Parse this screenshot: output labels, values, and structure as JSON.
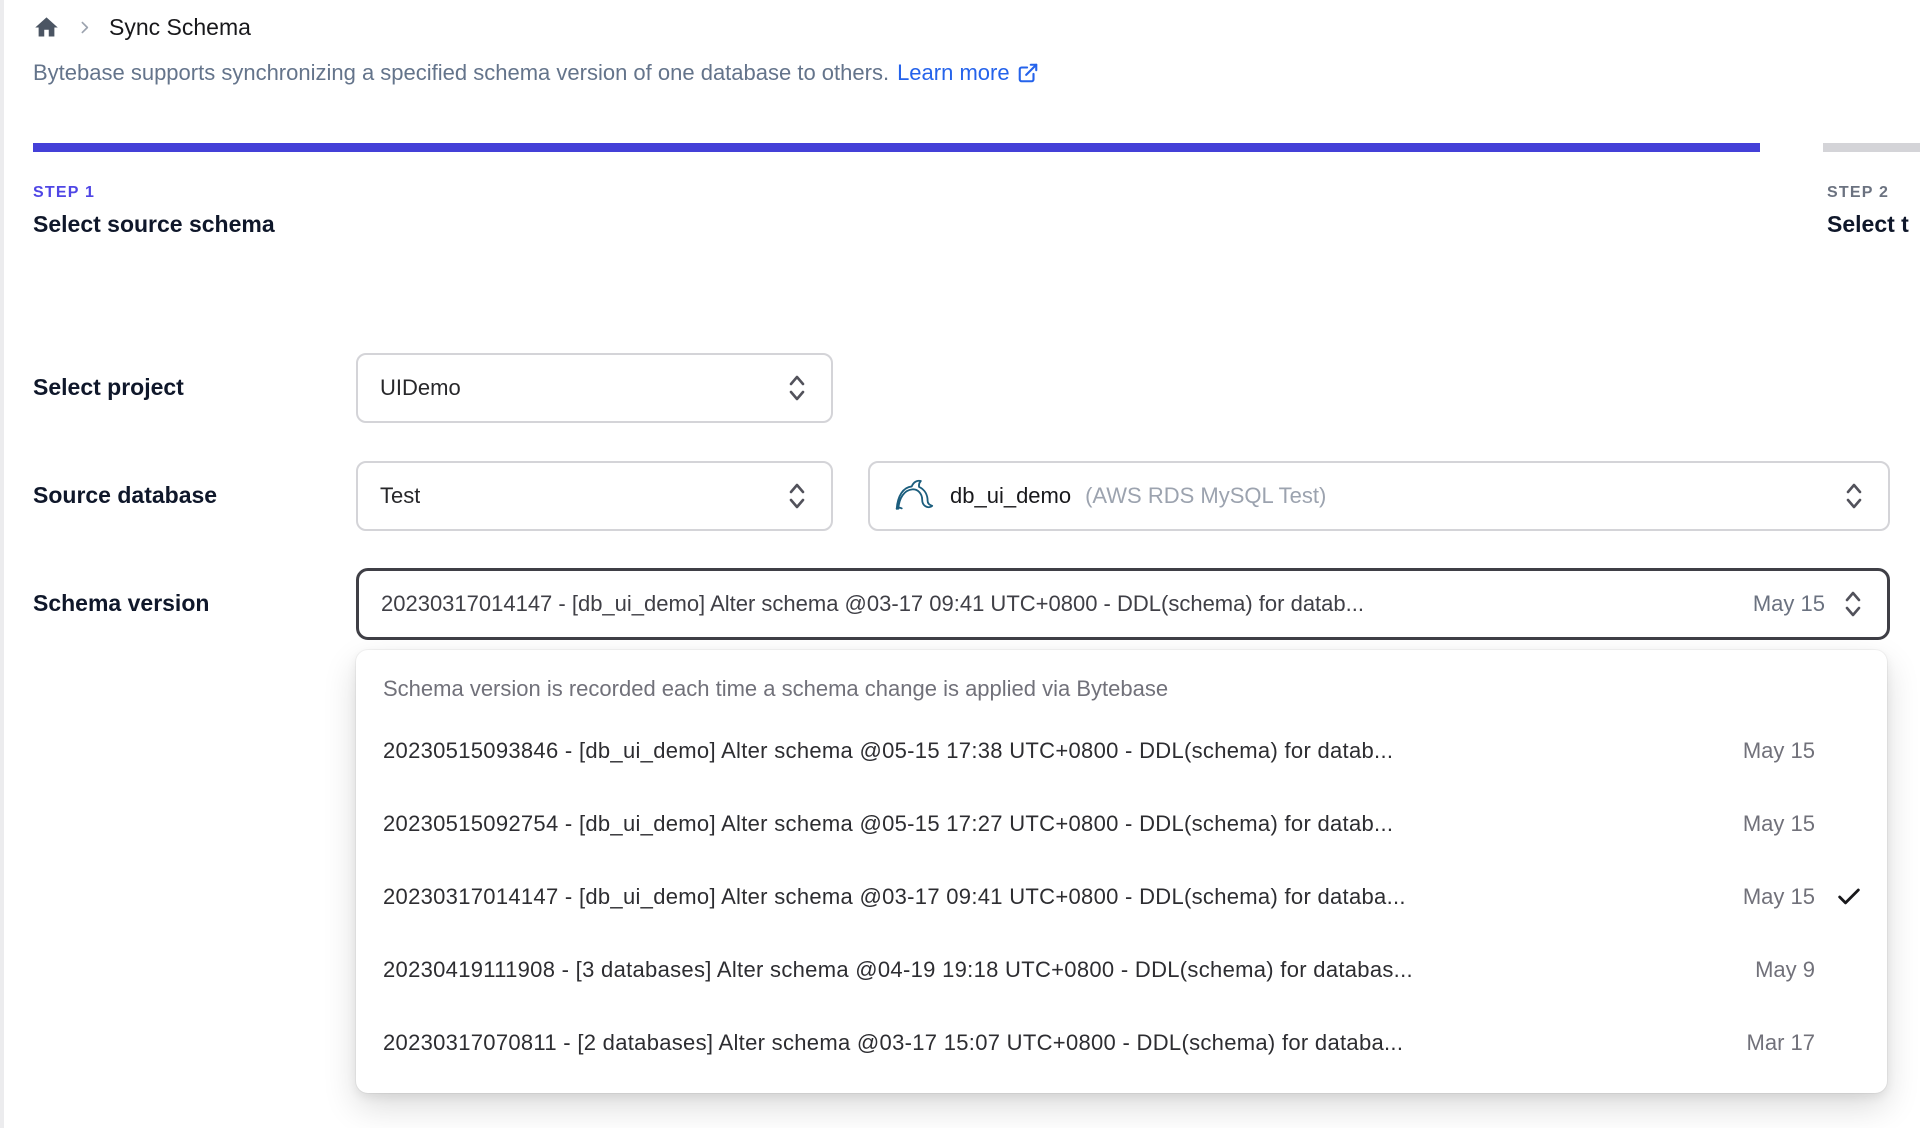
{
  "breadcrumb": {
    "home_icon": "home-icon",
    "title": "Sync Schema"
  },
  "description": {
    "text": "Bytebase supports synchronizing a specified schema version of one database to others.",
    "link_label": "Learn more",
    "link_icon": "external-link-icon"
  },
  "steps": [
    {
      "label": "STEP 1",
      "title": "Select source schema",
      "state": "active"
    },
    {
      "label": "STEP 2",
      "title": "Select t",
      "state": "upcoming"
    }
  ],
  "form": {
    "project": {
      "label": "Select project",
      "value": "UIDemo"
    },
    "source_database": {
      "label": "Source database",
      "environment_value": "Test",
      "database_icon": "mysql-dolphin-icon",
      "database_name": "db_ui_demo",
      "database_detail": "(AWS RDS MySQL Test)"
    },
    "schema_version": {
      "label": "Schema version",
      "value": "20230317014147 - [db_ui_demo] Alter schema @03-17 09:41 UTC+0800 - DDL(schema) for datab...",
      "value_date": "May 15"
    }
  },
  "dropdown": {
    "hint": "Schema version is recorded each time a schema change is applied via Bytebase",
    "options": [
      {
        "text": "20230515093846 - [db_ui_demo] Alter schema @05-15 17:38 UTC+0800 - DDL(schema) for datab...",
        "date": "May 15",
        "selected": false
      },
      {
        "text": "20230515092754 - [db_ui_demo] Alter schema @05-15 17:27 UTC+0800 - DDL(schema) for datab...",
        "date": "May 15",
        "selected": false
      },
      {
        "text": "20230317014147 - [db_ui_demo] Alter schema @03-17 09:41 UTC+0800 - DDL(schema) for databa...",
        "date": "May 15",
        "selected": true
      },
      {
        "text": "20230419111908 - [3 databases] Alter schema @04-19 19:18 UTC+0800 - DDL(schema) for databas...",
        "date": "May 9",
        "selected": false
      },
      {
        "text": "20230317070811 - [2 databases] Alter schema @03-17 15:07 UTC+0800 - DDL(schema) for databa...",
        "date": "Mar 17",
        "selected": false
      }
    ]
  },
  "colors": {
    "accent_indigo": "#4440d8",
    "step_active": "#4f46e5",
    "link_blue": "#2563eb",
    "progress_inactive": "#d4d4d8",
    "focused_border": "#3f3f46",
    "muted_text": "#71717a"
  }
}
